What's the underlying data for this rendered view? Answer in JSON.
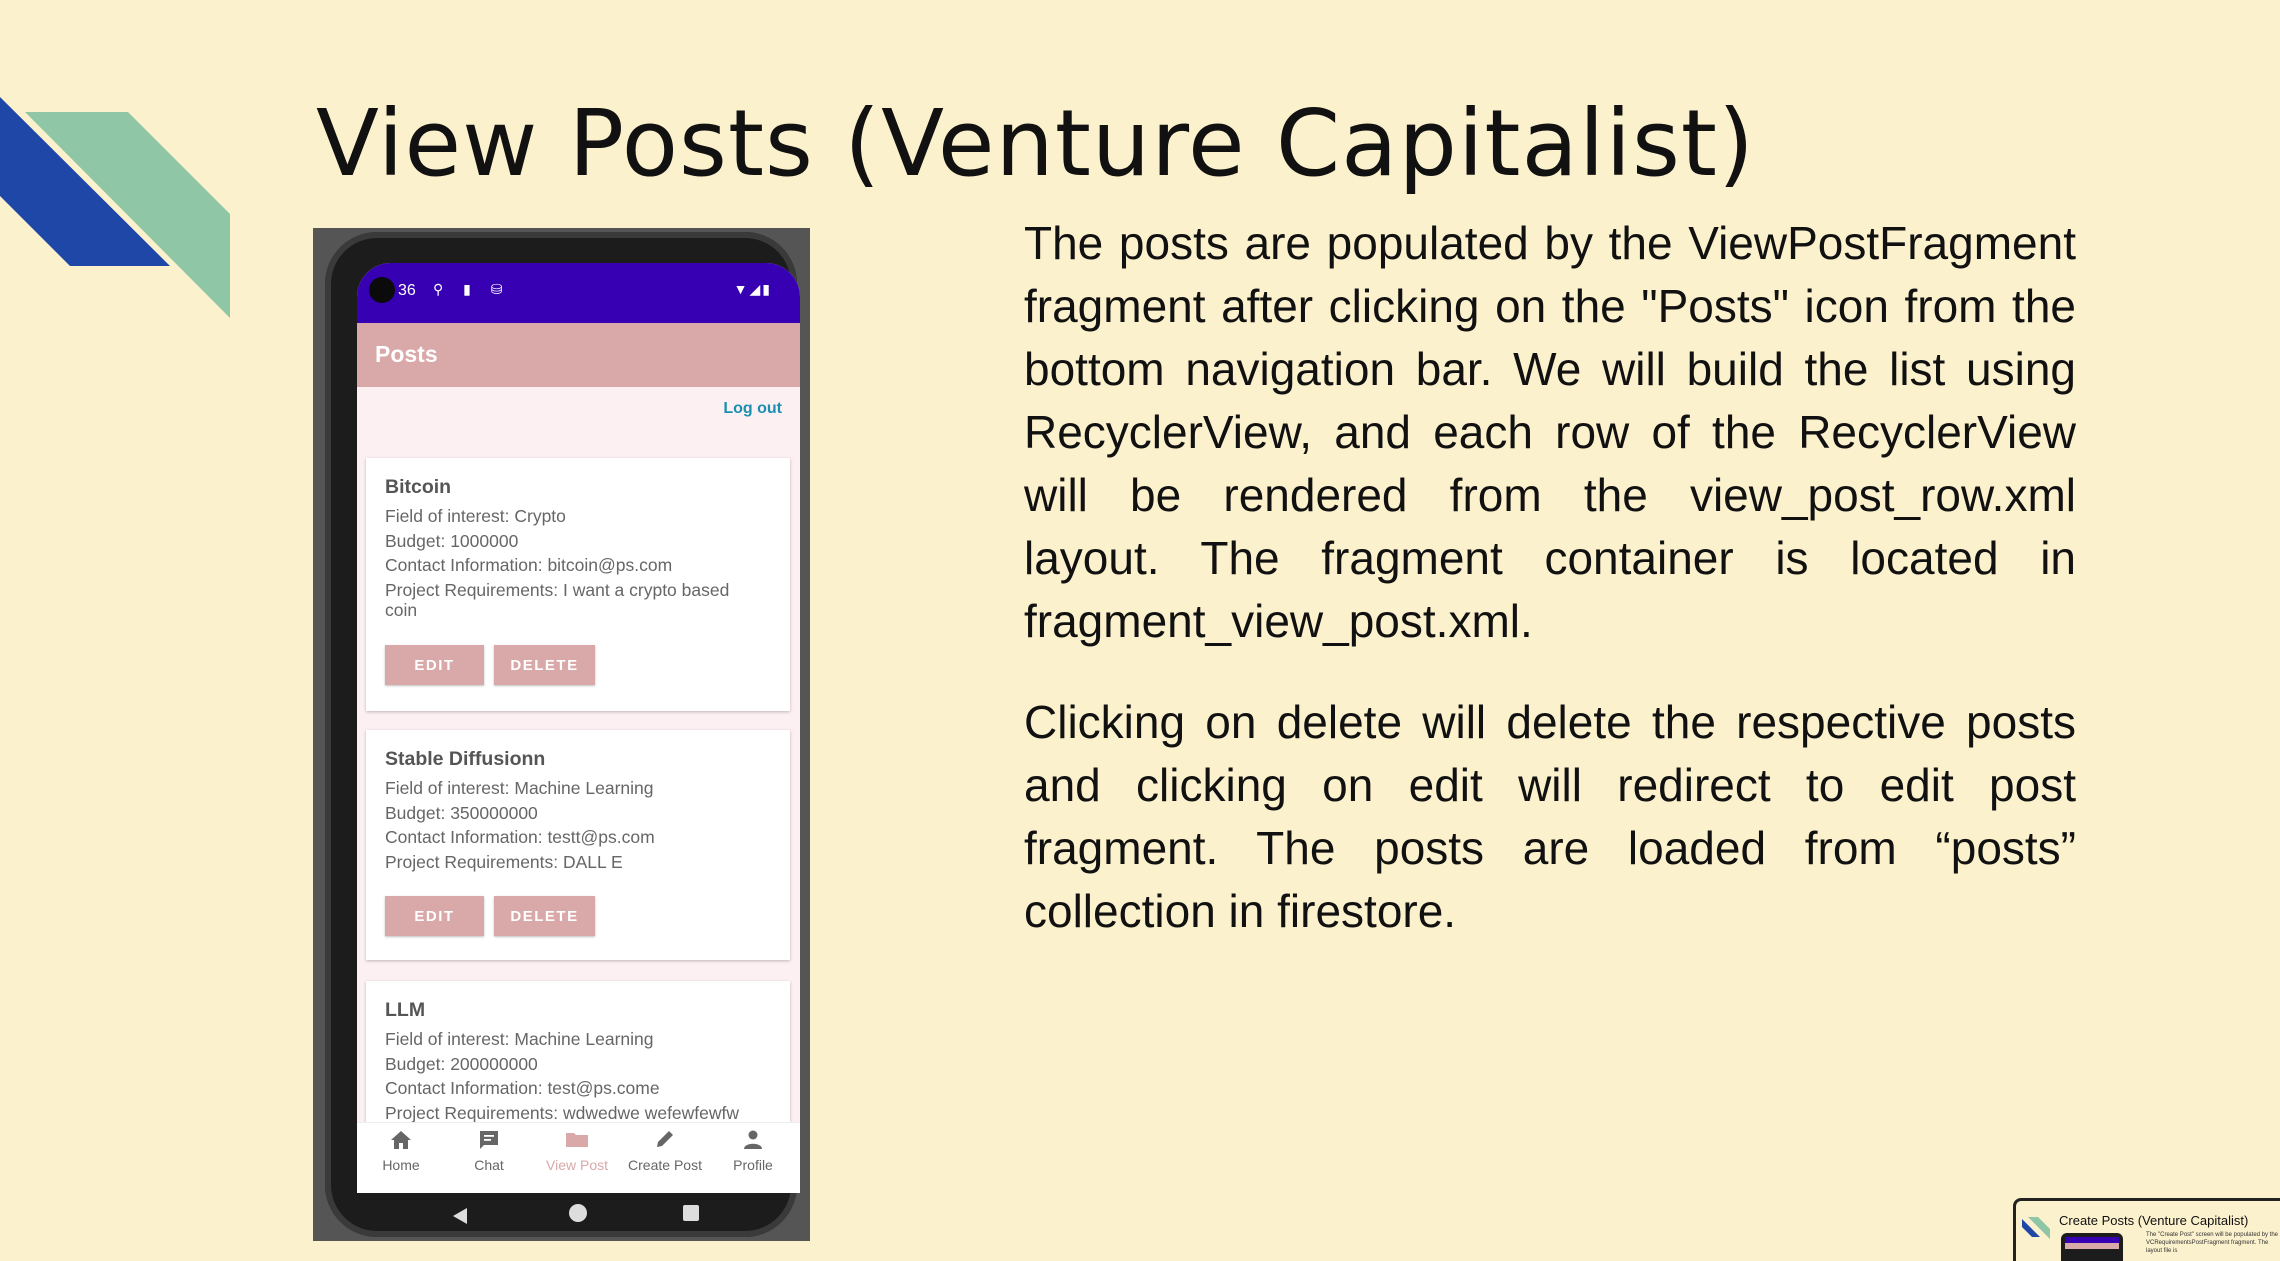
{
  "slide": {
    "title": "View Posts (Venture Capitalist)",
    "paragraphs": [
      "The posts are populated by the ViewPostFragment fragment after clicking on the \"Posts\" icon from the bottom navigation bar. We will build the list using RecyclerView, and each row of the RecyclerView will be rendered from the view_post_row.xml layout. The fragment container is located in fragment_view_post.xml.",
      "Clicking on delete will delete the respective posts and clicking on edit will redirect to edit post fragment. The posts are loaded from “posts” collection in firestore."
    ]
  },
  "colors": {
    "background": "#fcf1cd",
    "deco_blue": "#1f47a8",
    "deco_green": "#8fc6a5",
    "status_bar": "#3700b3",
    "app_bar": "#d9a8a8",
    "logout": "#1a8fb0"
  },
  "phone": {
    "status": {
      "time": "36",
      "left_icons": "⚲ ▮ ⛁",
      "right_icons": "▼◢▮"
    },
    "app_bar_title": "Posts",
    "logout_label": "Log out",
    "posts": [
      {
        "title": "Bitcoin",
        "field": "Field of interest: Crypto",
        "budget": "Budget: 1000000",
        "contact": "Contact Information: bitcoin@ps.com",
        "requirements": "Project Requirements: I want a crypto based coin",
        "edit_label": "EDIT",
        "delete_label": "DELETE"
      },
      {
        "title": "Stable Diffusionn",
        "field": "Field of interest: Machine Learning",
        "budget": "Budget: 350000000",
        "contact": "Contact Information: testt@ps.com",
        "requirements": "Project Requirements: DALL E",
        "edit_label": "EDIT",
        "delete_label": "DELETE"
      },
      {
        "title": "LLM",
        "field": "Field of interest: Machine Learning",
        "budget": "Budget: 200000000",
        "contact": "Contact Information: test@ps.come",
        "requirements": "Project Requirements: wdwedwe wefewfewfw"
      }
    ],
    "bottom_nav": [
      {
        "label": "Home",
        "icon": "home-icon",
        "active": false
      },
      {
        "label": "Chat",
        "icon": "chat-icon",
        "active": false
      },
      {
        "label": "View Post",
        "icon": "post-icon",
        "active": true
      },
      {
        "label": "Create Post",
        "icon": "pencil-icon",
        "active": false
      },
      {
        "label": "Profile",
        "icon": "person-icon",
        "active": false
      }
    ]
  },
  "thumbnail": {
    "title": "Create Posts (Venture Capitalist)",
    "text": "The \"Create Post\" screen will be populated by the VCRequirementsPostFragment fragment. The layout file is"
  }
}
